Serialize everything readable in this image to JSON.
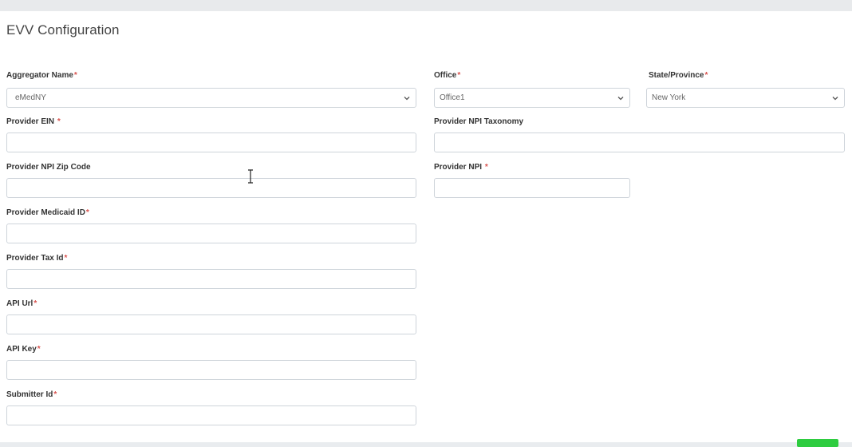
{
  "page": {
    "title": "EVV Configuration"
  },
  "required_marker": "*",
  "fields": {
    "aggregator": {
      "label": "Aggregator Name",
      "value": "eMedNY"
    },
    "office": {
      "label": "Office",
      "value": "Office1"
    },
    "state": {
      "label": "State/Province",
      "value": "New York"
    },
    "provider_ein": {
      "label": "Provider EIN ",
      "value": ""
    },
    "npi_taxonomy": {
      "label": "Provider NPI Taxonomy",
      "value": ""
    },
    "npi_zip": {
      "label": "Provider NPI Zip Code",
      "value": ""
    },
    "provider_npi": {
      "label": "Provider NPI ",
      "value": ""
    },
    "medicaid_id": {
      "label": "Provider Medicaid ID",
      "value": ""
    },
    "tax_id": {
      "label": "Provider Tax Id",
      "value": ""
    },
    "api_url": {
      "label": "API Url",
      "value": ""
    },
    "api_key": {
      "label": "API Key",
      "value": ""
    },
    "submitter_id": {
      "label": "Submitter Id",
      "value": ""
    }
  },
  "icons": {
    "chevron": "chevron-down-icon",
    "cursor": "text-cursor-icon"
  },
  "colors": {
    "required": "#d9534f",
    "save_button": "#2ecc40",
    "border": "#ced4da"
  }
}
